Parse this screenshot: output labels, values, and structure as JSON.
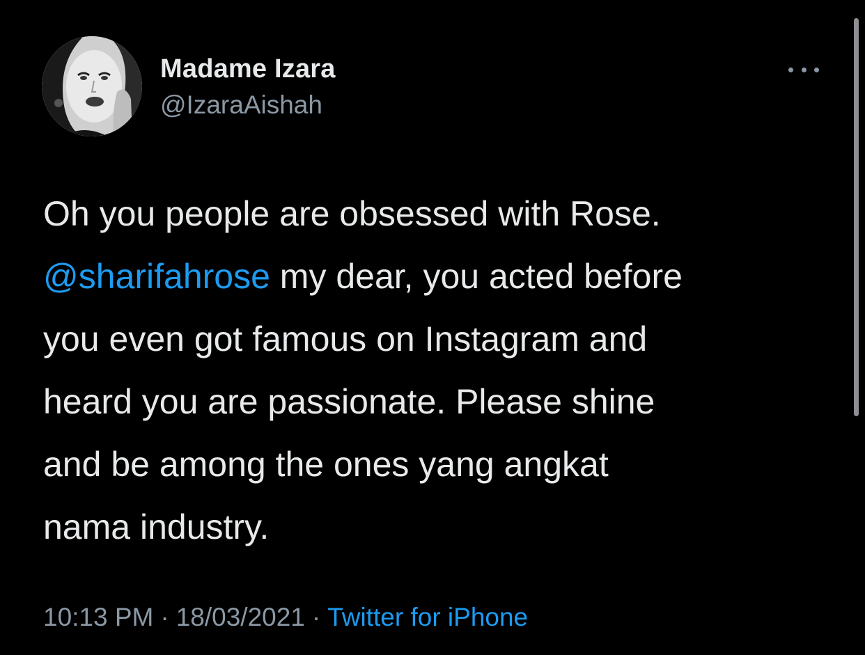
{
  "author": {
    "display_name": "Madame Izara",
    "handle": "@IzaraAishah",
    "avatar_icon": "profile-photo"
  },
  "tweet": {
    "lines": [
      [
        "Oh you people are obsessed with Rose."
      ],
      [
        "@sharifahrose",
        " my dear, you acted before"
      ],
      [
        "you even got famous on Instagram and"
      ],
      [
        "heard you are passionate. Please shine"
      ],
      [
        "and be among the ones yang angkat"
      ],
      [
        "nama industry."
      ]
    ],
    "mention": "@sharifahrose",
    "mention_rest": " my dear, you acted before"
  },
  "meta": {
    "time": "10:13 PM",
    "date": "18/03/2021",
    "separator": "·",
    "source": "Twitter for iPhone"
  },
  "colors": {
    "background": "#000000",
    "text": "#e7e9ea",
    "secondary": "#8b98a5",
    "link": "#1d9bf0"
  },
  "icons": {
    "more": "more-horizontal-icon"
  }
}
